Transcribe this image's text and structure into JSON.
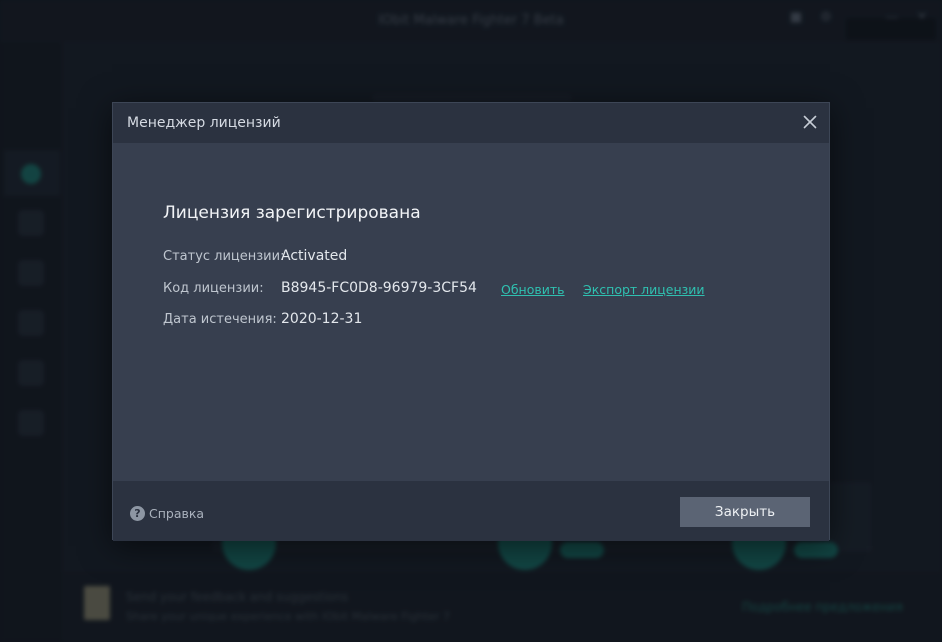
{
  "background": {
    "window_title": "IObit Malware Fighter 7 Beta",
    "bottom_panel": {
      "feedback_title": "Send your feedback and suggestions",
      "feedback_subtitle": "Share your unique experience with IObit Malware Fighter 7",
      "action_link": "Подробнее предложения"
    }
  },
  "dialog": {
    "title": "Менеджер лицензий",
    "close_icon": "close-icon",
    "heading": "Лицензия зарегистрирована",
    "fields": {
      "status": {
        "label": "Статус лицензии:",
        "value": "Activated"
      },
      "code": {
        "label": "Код лицензии:",
        "value": "B8945-FC0D8-96979-3CF54"
      },
      "expiry": {
        "label": "Дата истечения:",
        "value": "2020-12-31"
      }
    },
    "links": {
      "update": "Обновить",
      "export": "Экспорт лицензии"
    },
    "footer": {
      "help_label": "Справка",
      "help_icon": "question-icon",
      "close_button": "Закрыть"
    }
  },
  "colors": {
    "accent": "#2fc0b0",
    "dialog_body": "#373f4f",
    "dialog_header": "#2b3240",
    "button": "#5b6474"
  }
}
